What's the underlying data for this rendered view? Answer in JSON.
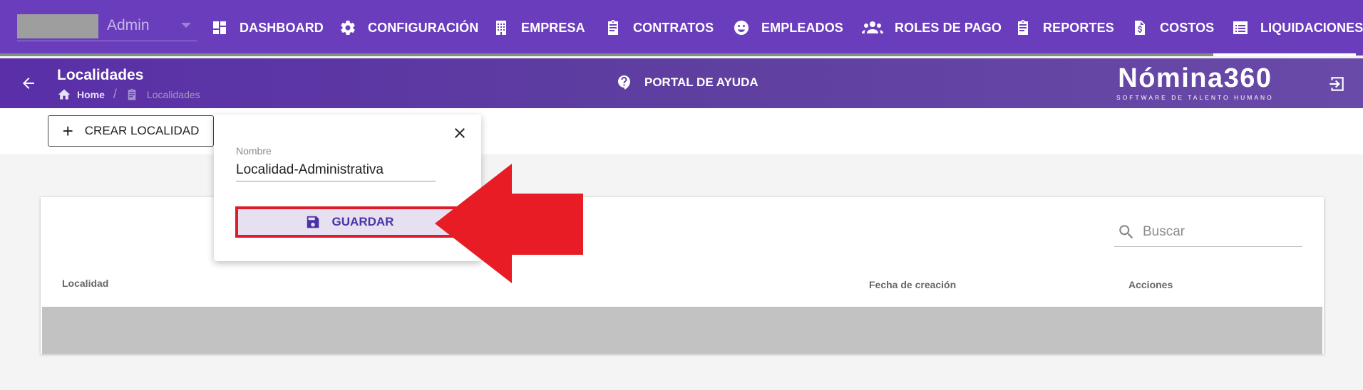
{
  "topnav": {
    "user_name": "Admin",
    "items": [
      {
        "label": "DASHBOARD",
        "icon": "dashboard-icon"
      },
      {
        "label": "CONFIGURACIÓN",
        "icon": "gear-icon"
      },
      {
        "label": "EMPRESA",
        "icon": "building-icon"
      },
      {
        "label": "CONTRATOS",
        "icon": "clipboard-icon"
      },
      {
        "label": "EMPLEADOS",
        "icon": "face-icon"
      },
      {
        "label": "ROLES DE PAGO",
        "icon": "people-icon"
      },
      {
        "label": "REPORTES",
        "icon": "clipboard-icon"
      },
      {
        "label": "COSTOS",
        "icon": "invoice-icon"
      },
      {
        "label": "LIQUIDACIONES",
        "icon": "list-icon"
      }
    ]
  },
  "header": {
    "title": "Localidades",
    "breadcrumb": {
      "home": "Home",
      "separator": "/",
      "current": "Localidades"
    },
    "help_label": "PORTAL DE AYUDA",
    "logo_text": "Nómina360",
    "logo_tagline": "SOFTWARE DE TALENTO HUMANO"
  },
  "toolbar": {
    "create_label": "CREAR LOCALIDAD"
  },
  "popover": {
    "field_label": "Nombre",
    "field_value": "Localidad-Administrativa",
    "save_label": "GUARDAR"
  },
  "table": {
    "search_placeholder": "Buscar",
    "columns": [
      "Localidad",
      "Fecha de creación",
      "Acciones"
    ]
  },
  "colors": {
    "nav_bg": "#6a3dbd",
    "header_bg": "#5a2fa8",
    "highlight_red": "#e01b2b",
    "save_bg": "#e6e0f1"
  }
}
